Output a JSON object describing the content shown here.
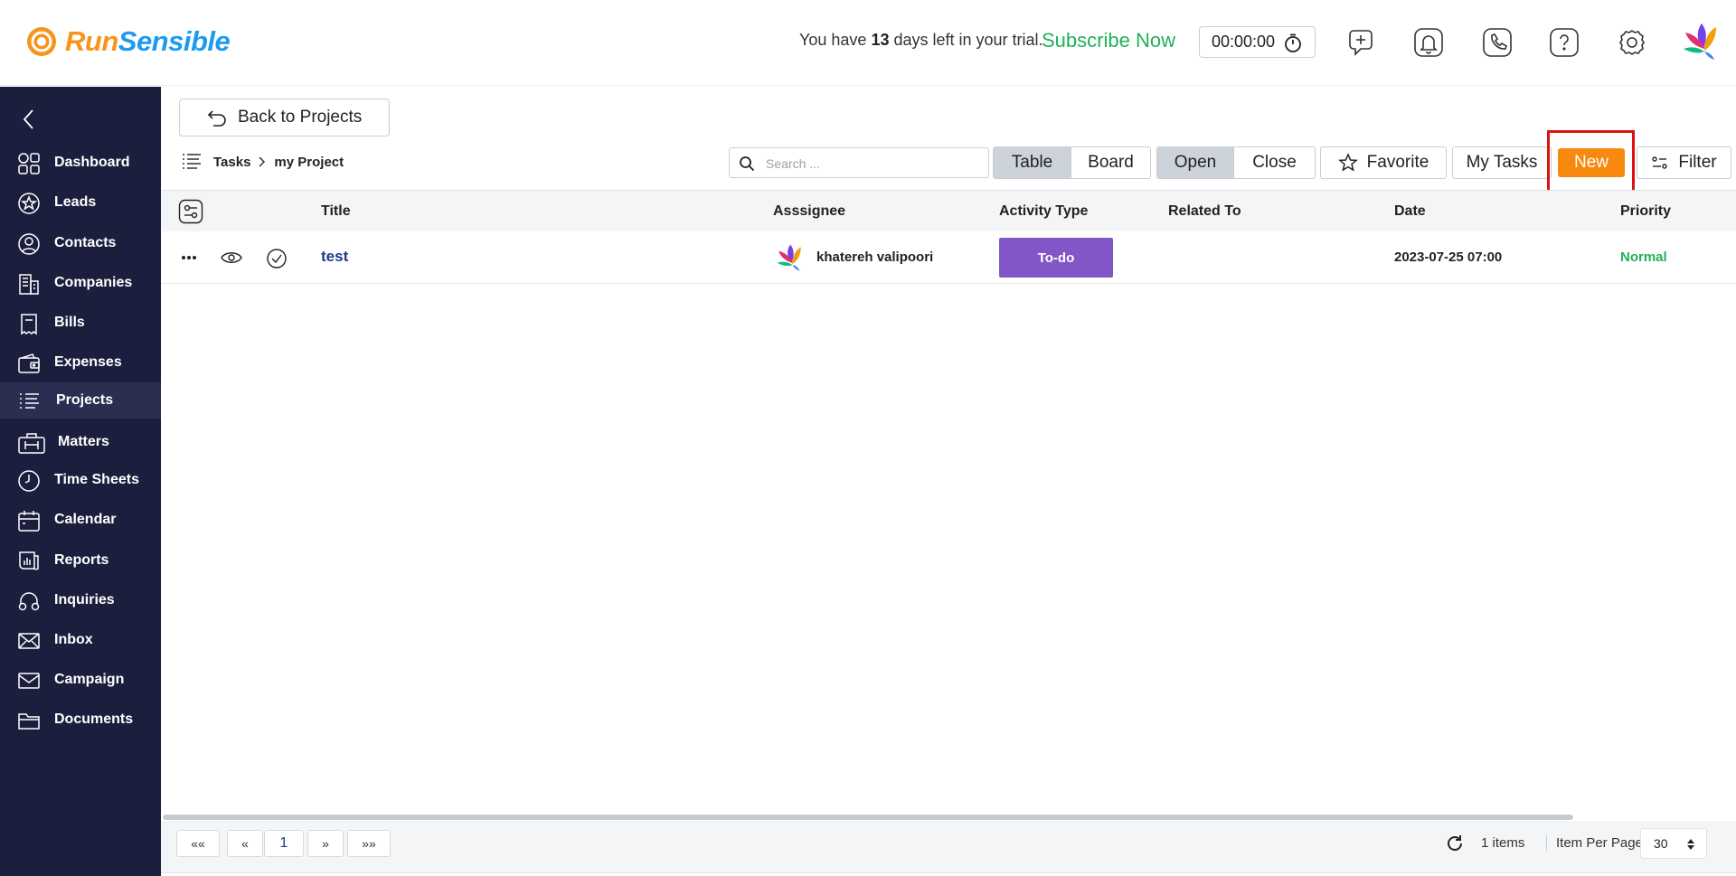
{
  "header": {
    "brand_run": "Run",
    "brand_sensible": "Sensible",
    "trial_prefix": "You have",
    "trial_days": "13",
    "trial_suffix": "days left in your trial.",
    "subscribe": "Subscribe Now",
    "timer": "00:00:00",
    "icons": [
      "add-activity-icon",
      "bell-icon",
      "phone-icon",
      "help-icon",
      "gear-icon",
      "user-avatar"
    ]
  },
  "sidebar": {
    "items": [
      {
        "label": "Dashboard",
        "icon": "dashboard-icon"
      },
      {
        "label": "Leads",
        "icon": "star-icon"
      },
      {
        "label": "Contacts",
        "icon": "contact-icon"
      },
      {
        "label": "Companies",
        "icon": "building-icon"
      },
      {
        "label": "Bills",
        "icon": "receipt-icon"
      },
      {
        "label": "Expenses",
        "icon": "wallet-icon"
      },
      {
        "label": "Projects",
        "icon": "list-icon"
      },
      {
        "label": "Matters",
        "icon": "briefcase-icon"
      },
      {
        "label": "Time Sheets",
        "icon": "clock-icon"
      },
      {
        "label": "Calendar",
        "icon": "calendar-icon"
      },
      {
        "label": "Reports",
        "icon": "report-icon"
      },
      {
        "label": "Inquiries",
        "icon": "headset-icon"
      },
      {
        "label": "Inbox",
        "icon": "inbox-icon"
      },
      {
        "label": "Campaign",
        "icon": "envelope-icon"
      },
      {
        "label": "Documents",
        "icon": "folder-icon"
      }
    ],
    "active": "Projects"
  },
  "toolbar": {
    "back": "Back to Projects",
    "breadcrumb_root": "Tasks",
    "breadcrumb_current": "my Project",
    "search_placeholder": "Search ...",
    "view_table": "Table",
    "view_board": "Board",
    "state_open": "Open",
    "state_close": "Close",
    "favorite": "Favorite",
    "my_tasks": "My Tasks",
    "new": "New",
    "filter": "Filter"
  },
  "table": {
    "columns": [
      "Title",
      "Asssignee",
      "Activity Type",
      "Related To",
      "Date",
      "Priority"
    ],
    "rows": [
      {
        "title": "test",
        "assignee": "khatereh valipoori",
        "activity_type": "To-do",
        "related_to": "",
        "date": "2023-07-25 07:00",
        "priority": "Normal"
      }
    ]
  },
  "footer": {
    "first": "««",
    "prev": "«",
    "page": "1",
    "next": "»",
    "last": "»»",
    "items_count": "1 items",
    "items_per_page_label": "Item Per Page",
    "items_per_page": "30"
  },
  "colors": {
    "sidebar_bg": "#1b1f3d",
    "new_button": "#f7890f",
    "todo_badge": "#8356c7",
    "priority_normal": "#1fb25a",
    "subscribe": "#1fb25a",
    "highlight": "#e01010"
  }
}
